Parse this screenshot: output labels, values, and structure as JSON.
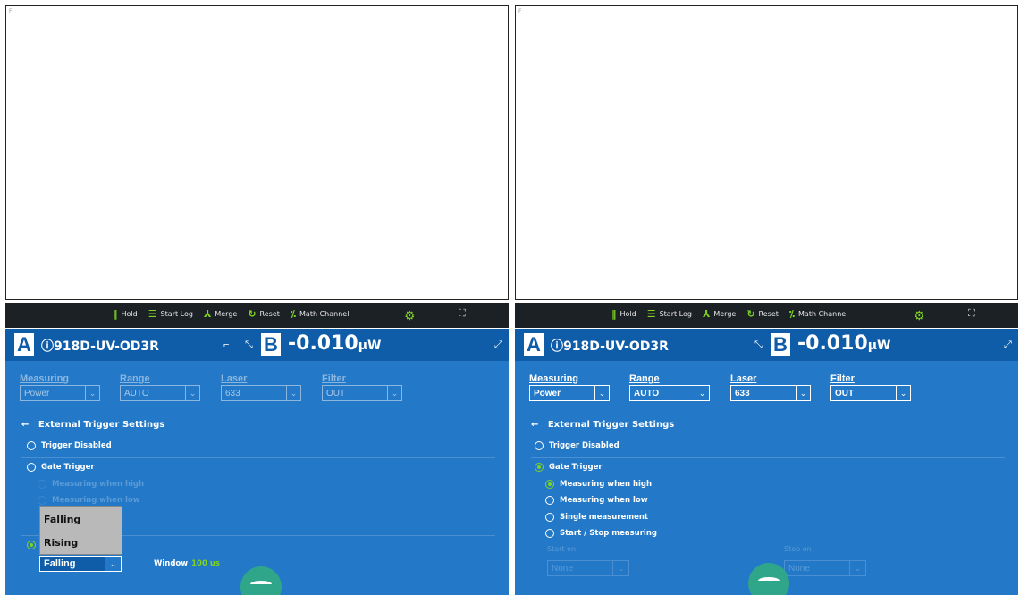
{
  "toolbar": {
    "hold": "Hold",
    "start_log": "Start Log",
    "merge": "Merge",
    "reset": "Reset",
    "math_channel": "Math Channel"
  },
  "left": {
    "channel_a": "A",
    "sensor_a": "ⓘ918D-UV-OD3R",
    "channel_b": "B",
    "reading_value": "-0.010",
    "reading_unit": "µW",
    "fields": [
      {
        "label": "Measuring",
        "value": "Power"
      },
      {
        "label": "Range",
        "value": "AUTO"
      },
      {
        "label": "Laser",
        "value": "633"
      },
      {
        "label": "Filter",
        "value": "OUT"
      }
    ],
    "section_title": "External Trigger Settings",
    "trigger_disabled": "Trigger Disabled",
    "gate_trigger": "Gate Trigger",
    "measuring_high": "Measuring when high",
    "measuring_low": "Measuring when low",
    "dropdown_options": [
      "Falling",
      "Rising"
    ],
    "edge_select_value": "Falling",
    "window_label": "Window",
    "window_value": "100 us"
  },
  "right": {
    "channel_a": "A",
    "sensor_a": "ⓘ918D-UV-OD3R",
    "channel_b": "B",
    "reading_value": "-0.010",
    "reading_unit": "µW",
    "fields": [
      {
        "label": "Measuring",
        "value": "Power"
      },
      {
        "label": "Range",
        "value": "AUTO"
      },
      {
        "label": "Laser",
        "value": "633"
      },
      {
        "label": "Filter",
        "value": "OUT"
      }
    ],
    "section_title": "External Trigger Settings",
    "trigger_disabled": "Trigger Disabled",
    "gate_trigger": "Gate Trigger",
    "measuring_high": "Measuring when high",
    "measuring_low": "Measuring when low",
    "single_measurement": "Single measurement",
    "start_stop": "Start / Stop measuring",
    "start_on_label": "Start on",
    "start_on_value": "None",
    "stop_on_label": "Stop on",
    "stop_on_value": "None"
  },
  "colors": {
    "accent": "#7ed321",
    "header_blue": "#0f5ca8",
    "body_blue": "#2379c7",
    "toolbar_bg": "#1c2126"
  }
}
